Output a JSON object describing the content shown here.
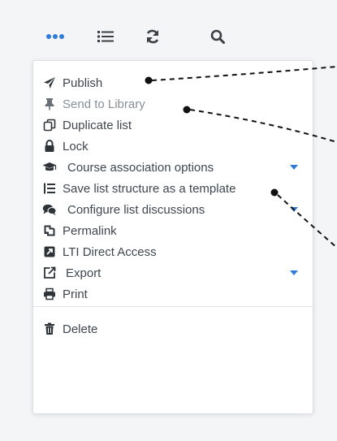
{
  "toolbar": {
    "buttons": [
      {
        "icon": "more-icon",
        "color": "#2f7bd8"
      },
      {
        "icon": "list-icon",
        "color": "#3a3f45"
      },
      {
        "icon": "refresh-icon",
        "color": "#3a3f45"
      },
      {
        "icon": "search-icon",
        "color": "#3a3f45"
      }
    ]
  },
  "menu": {
    "items": [
      {
        "label": "Publish",
        "icon": "paper-plane-icon",
        "disabled": false,
        "has_submenu": false
      },
      {
        "label": "Send to Library",
        "icon": "pin-icon",
        "disabled": true,
        "has_submenu": false
      },
      {
        "label": "Duplicate list",
        "icon": "copy-icon",
        "disabled": false,
        "has_submenu": false
      },
      {
        "label": "Lock",
        "icon": "lock-icon",
        "disabled": false,
        "has_submenu": false
      },
      {
        "label": "Course association options",
        "icon": "graduation-cap-icon",
        "disabled": false,
        "has_submenu": true
      },
      {
        "label": "Save list structure as a template",
        "icon": "list-template-icon",
        "disabled": false,
        "has_submenu": false
      },
      {
        "label": "Configure list discussions",
        "icon": "comments-icon",
        "disabled": false,
        "has_submenu": true
      },
      {
        "label": "Permalink",
        "icon": "permalink-icon",
        "disabled": false,
        "has_submenu": false
      },
      {
        "label": "LTI Direct Access",
        "icon": "external-square-icon",
        "disabled": false,
        "has_submenu": false
      },
      {
        "label": "Export",
        "icon": "export-icon",
        "disabled": false,
        "has_submenu": true
      },
      {
        "label": "Print",
        "icon": "print-icon",
        "disabled": false,
        "has_submenu": false
      }
    ],
    "delete_item": {
      "label": "Delete",
      "icon": "trash-icon"
    }
  },
  "colors": {
    "accent": "#2f7bd8",
    "text": "#3f4650",
    "disabled_text": "#8a8f96",
    "icon": "#2e3338"
  }
}
